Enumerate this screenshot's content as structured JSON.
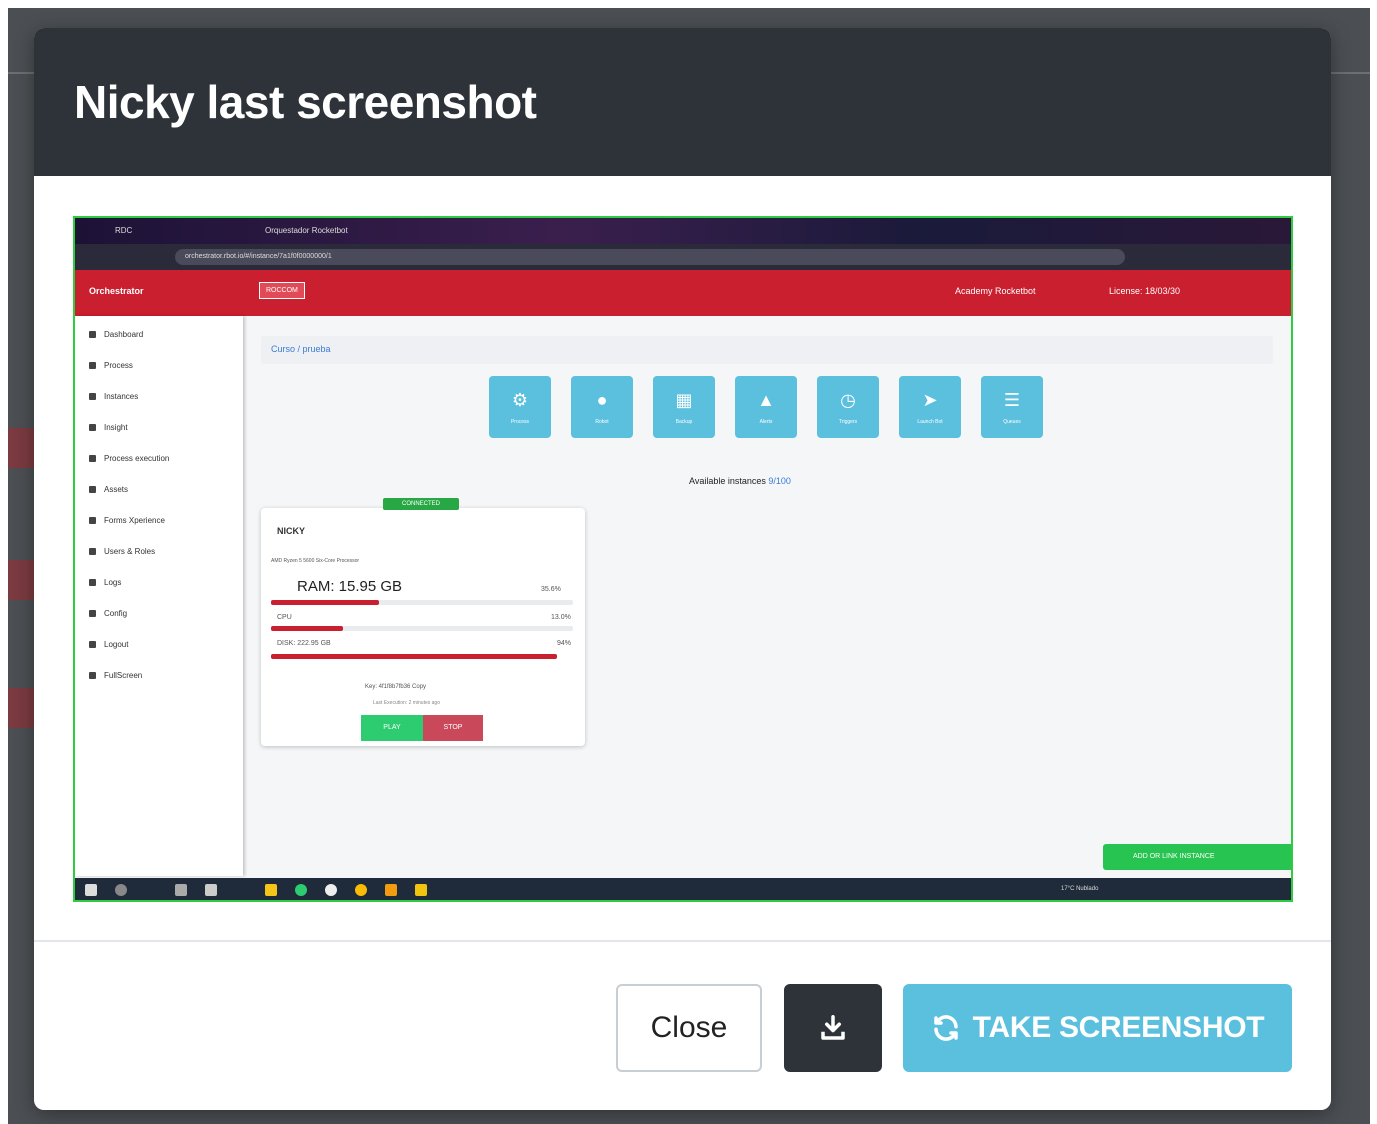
{
  "modal": {
    "title": "Nicky last screenshot",
    "close_label": "Close",
    "take_label": "TAKE SCREENSHOT"
  },
  "screenshot": {
    "tab_label": "RDC",
    "tab2_label": "Orquestador Rocketbot",
    "url": "orchestrator.rbot.io/#/instance/7a1f0f0000000/1",
    "app_name": "Orchestrator",
    "header_badge": "ROCCOM",
    "header_right_1": "Academy Rocketbot",
    "header_right_2": "License: 18/03/30",
    "sidebar_items": [
      "Dashboard",
      "Process",
      "Instances",
      "Insight",
      "Process execution",
      "Assets",
      "Forms Xperience",
      "Users & Roles",
      "Logs",
      "Config",
      "Logout",
      "FullScreen"
    ],
    "breadcrumb": "Curso / prueba",
    "tiles": [
      "Process",
      "Robot",
      "Backup",
      "Alerts",
      "Triggers",
      "Launch Bot",
      "Queues"
    ],
    "available_label": "Available instances",
    "available_count": "9/100",
    "card": {
      "status": "CONNECTED",
      "name": "NICKY",
      "cpu_model": "AMD Ryzen 5 5600 Six-Core Processor",
      "ram_label": "RAM: 15.95 GB",
      "ram_pct": "35.6%",
      "cpu_label": "CPU",
      "cpu_pct": "13.0%",
      "disk_label": "DISK: 222.95 GB",
      "disk_pct": "94%",
      "key": "Key: 4f1f8b7fb36 Copy",
      "last_execution": "Last Execution: 2 minutes ago",
      "play_label": "PLAY",
      "stop_label": "STOP"
    },
    "add_link_label": "ADD OR LINK INSTANCE",
    "taskbar_weather": "17°C Nublado"
  }
}
